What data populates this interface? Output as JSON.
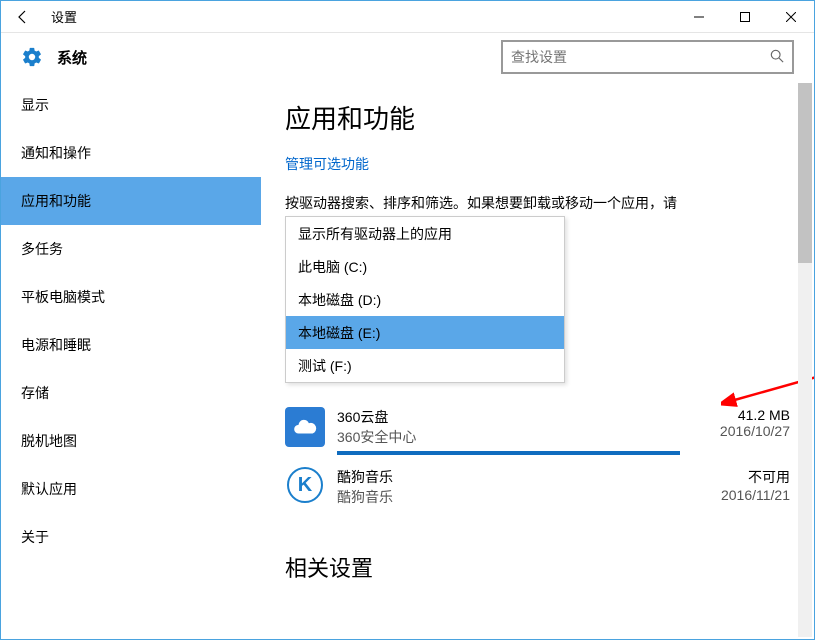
{
  "titlebar": {
    "title": "设置"
  },
  "subheader": {
    "title": "系统"
  },
  "search": {
    "placeholder": "查找设置"
  },
  "sidebar": {
    "items": [
      {
        "label": "显示"
      },
      {
        "label": "通知和操作"
      },
      {
        "label": "应用和功能",
        "active": true
      },
      {
        "label": "多任务"
      },
      {
        "label": "平板电脑模式"
      },
      {
        "label": "电源和睡眠"
      },
      {
        "label": "存储"
      },
      {
        "label": "脱机地图"
      },
      {
        "label": "默认应用"
      },
      {
        "label": "关于"
      }
    ]
  },
  "main": {
    "heading": "应用和功能",
    "manage_link": "管理可选功能",
    "description": "按驱动器搜索、排序和筛选。如果想要卸载或移动一个应用，请",
    "dropdown": {
      "options": [
        {
          "label": "显示所有驱动器上的应用"
        },
        {
          "label": "此电脑 (C:)"
        },
        {
          "label": "本地磁盘 (D:)"
        },
        {
          "label": "本地磁盘 (E:)",
          "selected": true
        },
        {
          "label": "测试 (F:)"
        }
      ]
    },
    "apps": [
      {
        "name": "360云盘",
        "publisher": "360安全中心",
        "size": "41.2 MB",
        "date": "2016/10/27",
        "icon": "cloud"
      },
      {
        "name": "酷狗音乐",
        "publisher": "酷狗音乐",
        "size": "不可用",
        "date": "2016/11/21",
        "icon": "K"
      }
    ],
    "related_heading": "相关设置"
  }
}
